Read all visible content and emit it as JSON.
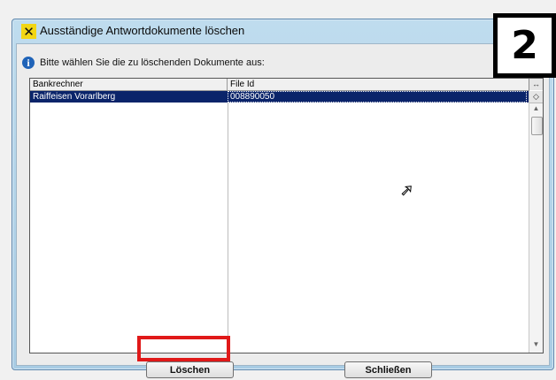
{
  "window": {
    "title": "Ausständige Antwortdokumente löschen",
    "app_icon": "raiffeisen-cross-icon"
  },
  "info": {
    "icon": "info-icon",
    "text": "Bitte wählen Sie die zu löschenden Dokumente aus:"
  },
  "table": {
    "columns": [
      "Bankrechner",
      "File Id"
    ],
    "rows": [
      {
        "bankrechner": "Raiffeisen Vorarlberg",
        "file_id": "008890050",
        "selected": true
      }
    ],
    "column_selector_glyph": "↔",
    "zoom_glyph": "◇"
  },
  "buttons": {
    "delete_label": "Löschen",
    "close_label": "Schließen"
  },
  "annotation": {
    "step_number": "2",
    "highlight_color": "#e01919"
  },
  "colors": {
    "selection": "#0a246a",
    "title_bar": "#bfdcee"
  }
}
